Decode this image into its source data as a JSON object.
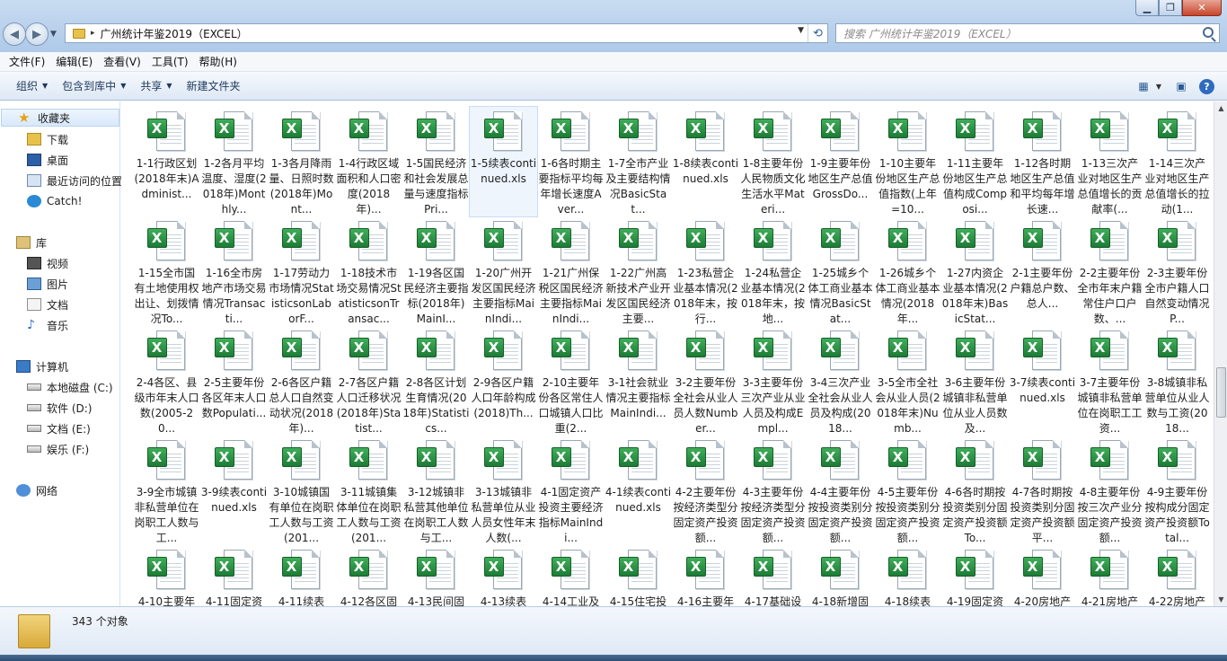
{
  "window": {
    "address_path": "广州统计年鉴2019（EXCEL）",
    "search_placeholder": "搜索 广州统计年鉴2019（EXCEL）"
  },
  "menu": [
    "文件(F)",
    "编辑(E)",
    "查看(V)",
    "工具(T)",
    "帮助(H)"
  ],
  "toolbar": {
    "organize": "组织",
    "include_library": "包含到库中",
    "share": "共享",
    "new_folder": "新建文件夹"
  },
  "nav": {
    "favorites": "收藏夹",
    "downloads": "下载",
    "desktop": "桌面",
    "recent": "最近访问的位置",
    "catch": "Catch!",
    "libraries": "库",
    "videos": "视频",
    "pictures": "图片",
    "documents": "文档",
    "music": "音乐",
    "computer": "计算机",
    "drive_c": "本地磁盘 (C:)",
    "drive_d": "软件 (D:)",
    "drive_e": "文档 (E:)",
    "drive_f": "娱乐 (F:)",
    "network": "网络"
  },
  "files": [
    "1-1行政区划(2018年末)Administ...",
    "1-2各月平均温度、湿度(2018年)Monthly...",
    "1-3各月降雨量、日照时数(2018年)Mont...",
    "1-4行政区域面积和人口密度(2018年)...",
    "1-5国民经济和社会发展总量与速度指标Pri...",
    "1-5续表continued.xls",
    "1-6各时期主要指标平均每年增长速度Aver...",
    "1-7全市产业及主要结构情况BasicStat...",
    "1-8续表continued.xls",
    "1-8主要年份人民物质文化生活水平Materi...",
    "1-9主要年份地区生产总值GrossDo...",
    "1-10主要年份地区生产总值指数(上年=10...",
    "1-11主要年份地区生产总值构成Composi...",
    "1-12各时期地区生产总值和平均每年增长速...",
    "1-13三次产业对地区生产总值增长的贡献率(...",
    "1-14三次产业对地区生产总值增长的拉动(1...",
    "1-15全市国有土地使用权出让、划拨情况To...",
    "1-16全市房地产市场交易情况Transacti...",
    "1-17劳动力市场情况StatisticsonLaborF...",
    "1-18技术市场交易情况StatisticsonTransac...",
    "1-19各区国民经济主要指标(2018年)MainI...",
    "1-20广州开发区国民经济主要指标MainIndi...",
    "1-21广州保税区国民经济主要指标MainIndi...",
    "1-22广州高新技术产业开发区国民经济主要...",
    "1-23私营企业基本情况(2018年末，按行...",
    "1-24私营企业基本情况(2018年末，按地...",
    "1-25城乡个体工商业基本情况BasicStat...",
    "1-26城乡个体工商业基本情况(2018年...",
    "1-27内资企业基本情况(2018年末)BasicStat...",
    "2-1主要年份户籍总户数、总人...",
    "2-2主要年份全市年末户籍常住户口户数、...",
    "2-3主要年份全市户籍人口自然变动情况P...",
    "2-4各区、县级市年末人口数(2005-20...",
    "2-5主要年份各区年末人口数Populati...",
    "2-6各区户籍总人口自然变动状况(2018年)...",
    "2-7各区户籍人口迁移状况(2018年)Statist...",
    "2-8各区计划生育情况(2018年)Statistics...",
    "2-9各区户籍人口年龄构成(2018)Th...",
    "2-10主要年份各区常住人口城镇人口比重(2...",
    "3-1社会就业情况主要指标MainIndi...",
    "3-2主要年份全社会从业人员人数Number...",
    "3-3主要年份三次产业从业人员及构成Empl...",
    "3-4三次产业全社会从业人员及构成(2018...",
    "3-5全市全社会从业人员(2018年末)Numb...",
    "3-6主要年份城镇非私营单位从业人员数及...",
    "3-7续表continued.xls",
    "3-7主要年份城镇非私营单位在岗职工工资...",
    "3-8城镇非私营单位从业人数与工资(2018...",
    "3-9全市城镇非私营单位在岗职工人数与工...",
    "3-9续表continued.xls",
    "3-10城镇国有单位在岗职工人数与工资(201...",
    "3-11城镇集体单位在岗职工人数与工资(201...",
    "3-12城镇非私营其他单位在岗职工人数与工...",
    "3-13城镇非私营单位从业人员女性年末人数(...",
    "4-1固定资产投资主要经济指标MainIndi...",
    "4-1续表continued.xls",
    "4-2主要年份按经济类型分固定资产投资额...",
    "4-3主要年份按经济类型分固定资产投资额...",
    "4-4主要年份按投资类别分固定资产投资额...",
    "4-5主要年份按投资类别分固定资产投资额...",
    "4-6各时期按投资类别分固定资产投资额To...",
    "4-7各时期按投资类别分固定资产投资额平...",
    "4-8主要年份按三次产业分固定资产投资额...",
    "4-9主要年份按构成分固定资产投资额Total...",
    "4-10主要年",
    "4-11固定资",
    "4-11续表",
    "4-12各区固",
    "4-13民间固",
    "4-13续表",
    "4-14工业及",
    "4-15住宅投",
    "4-16主要年",
    "4-17基础设",
    "4-18新增固",
    "4-18续表",
    "4-19固定资",
    "4-20房地产",
    "4-21房地产",
    "4-22房地产"
  ],
  "selected_file_index": 5,
  "status": {
    "count": "343 个对象"
  }
}
